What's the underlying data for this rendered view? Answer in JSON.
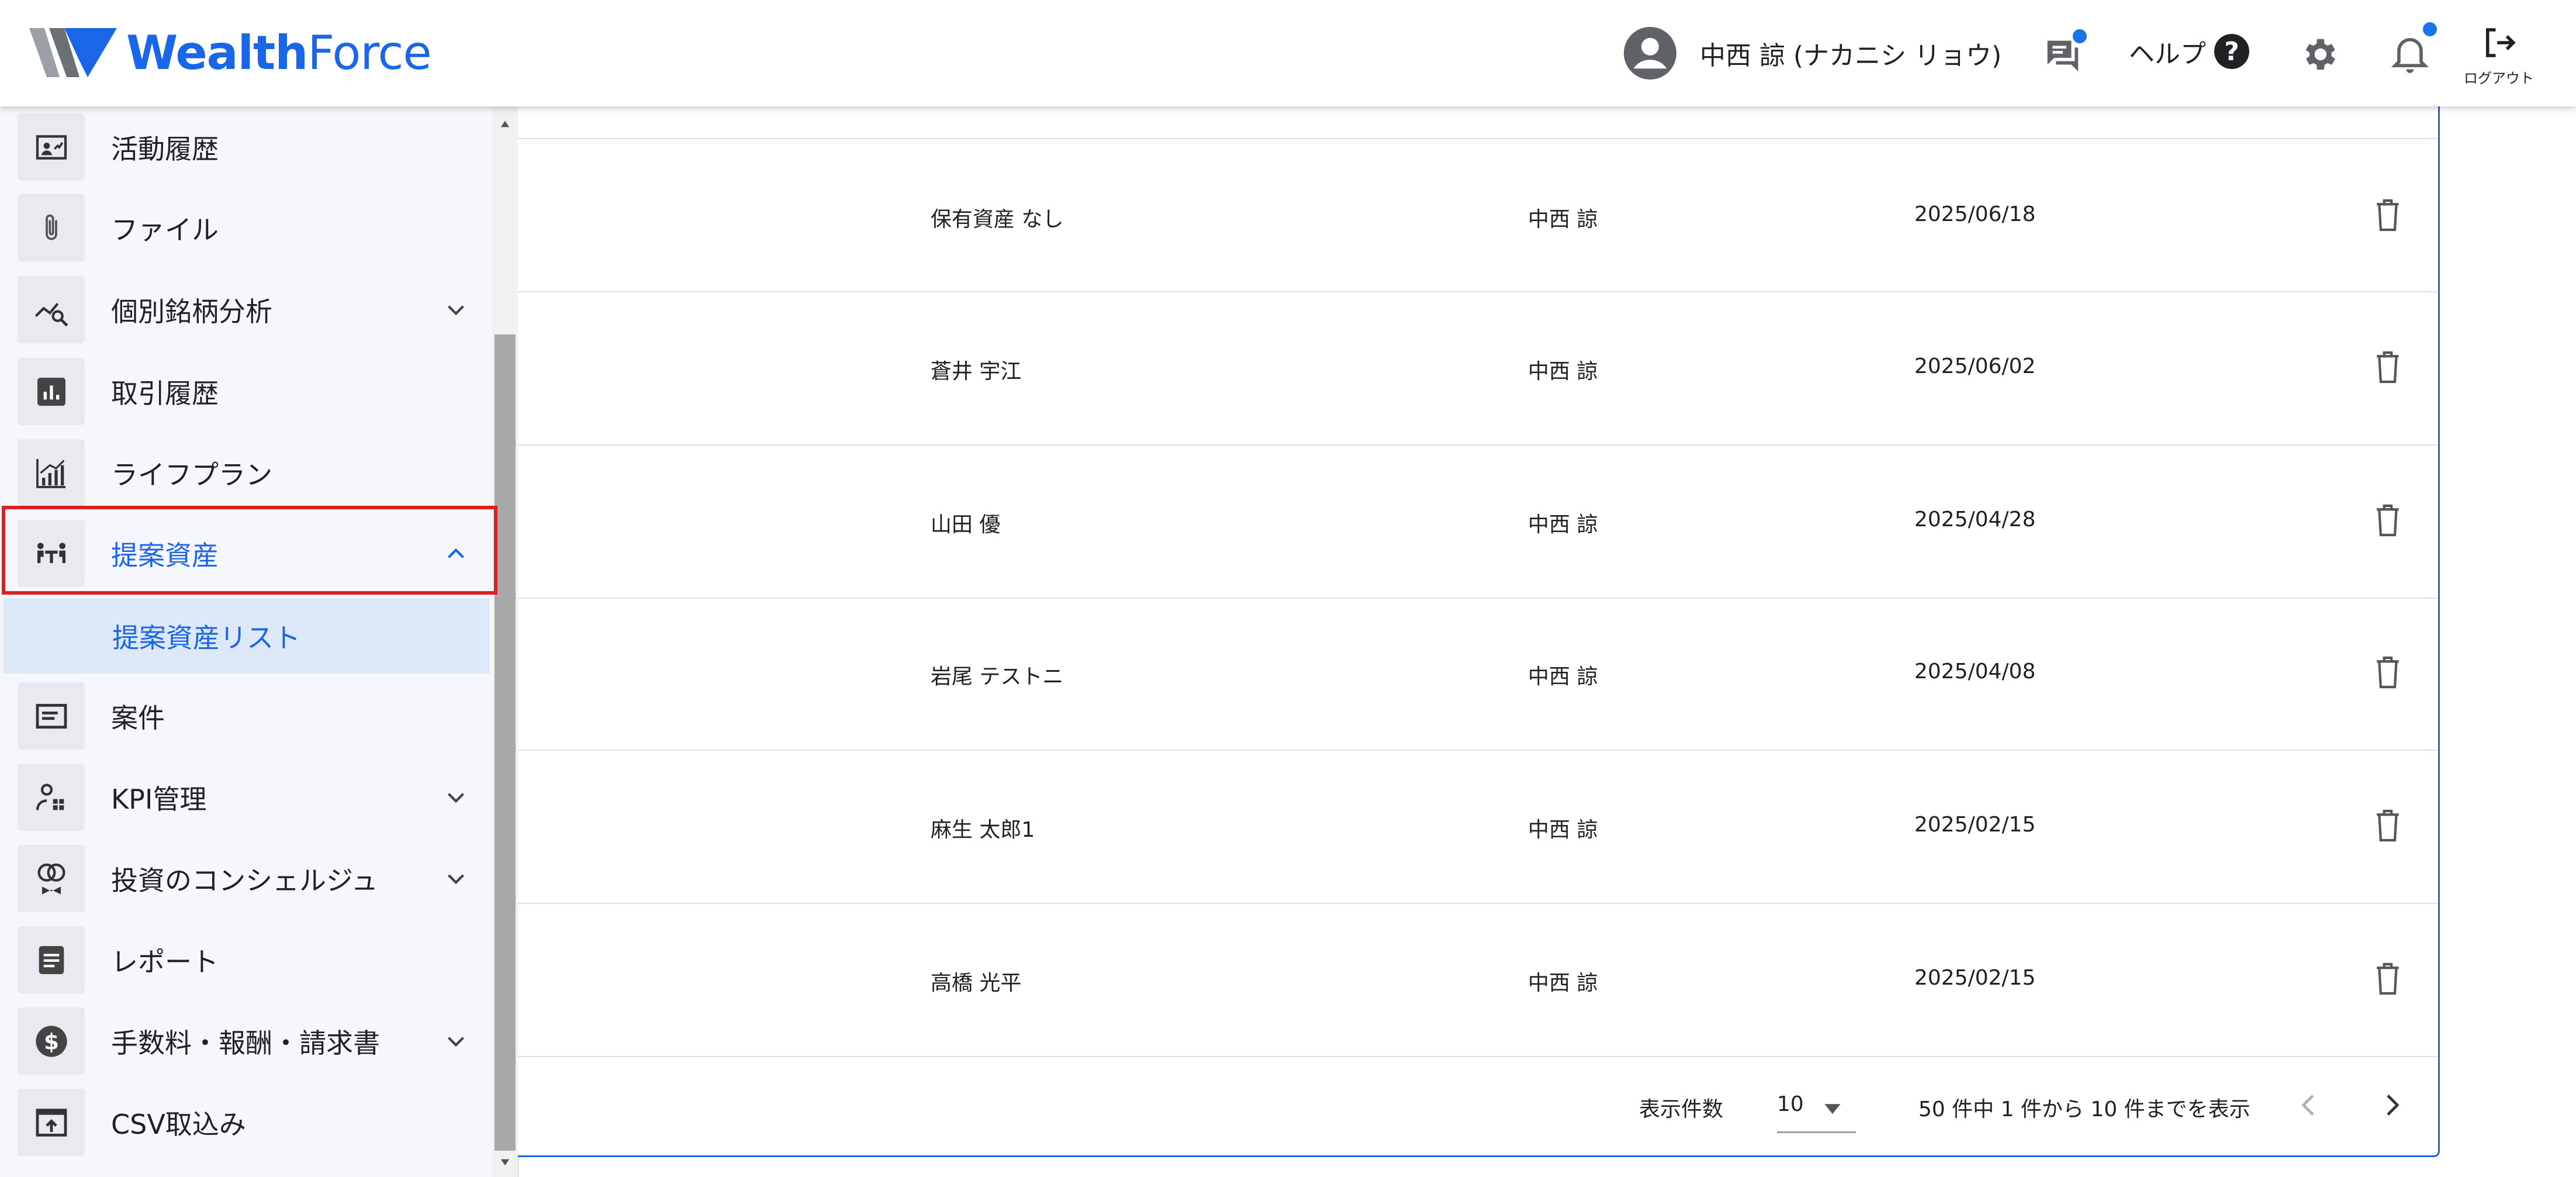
{
  "app": {
    "logo_word1": "Wealth",
    "logo_word2": "Force",
    "brand_color": "#1a66e8"
  },
  "header": {
    "user_name": "中西 諒 (ナカニシ リョウ)",
    "help_label": "ヘルプ",
    "help_glyph": "?",
    "logout_label": "ログアウト",
    "icons": [
      "account-circle-icon",
      "chat-icon",
      "help-icon",
      "gear-icon",
      "bell-icon",
      "logout-icon"
    ]
  },
  "sidebar": {
    "items": [
      {
        "label": "活動履歴",
        "icon": "activity-history-icon",
        "expandable": false
      },
      {
        "label": "ファイル",
        "icon": "paperclip-icon",
        "expandable": false
      },
      {
        "label": "個別銘柄分析",
        "icon": "chart-search-icon",
        "expandable": true
      },
      {
        "label": "取引履歴",
        "icon": "bar-chart-icon",
        "expandable": false
      },
      {
        "label": "ライフプラン",
        "icon": "growth-chart-icon",
        "expandable": false
      },
      {
        "label": "提案資産",
        "icon": "meeting-icon",
        "expandable": true,
        "expanded": true,
        "active": true
      },
      {
        "label": "案件",
        "icon": "card-icon",
        "expandable": false
      },
      {
        "label": "KPI管理",
        "icon": "person-stats-icon",
        "expandable": true
      },
      {
        "label": "投資のコンシェルジュ",
        "icon": "concierge-icon",
        "expandable": true
      },
      {
        "label": "レポート",
        "icon": "document-icon",
        "expandable": false
      },
      {
        "label": "手数料・報酬・請求書",
        "icon": "dollar-icon",
        "expandable": true
      },
      {
        "label": "CSV取込み",
        "icon": "upload-icon",
        "expandable": false
      }
    ],
    "subitem": {
      "label": "提案資産リスト"
    }
  },
  "table": {
    "rows": [
      {
        "name": "保有資産 なし",
        "owner": "中西 諒",
        "date": "2025/06/18"
      },
      {
        "name": "蒼井 宇江",
        "owner": "中西 諒",
        "date": "2025/06/02"
      },
      {
        "name": "山田 優",
        "owner": "中西 諒",
        "date": "2025/04/28"
      },
      {
        "name": "岩尾 テストニ",
        "owner": "中西 諒",
        "date": "2025/04/08"
      },
      {
        "name": "麻生 太郎1",
        "owner": "中西 諒",
        "date": "2025/02/15"
      },
      {
        "name": "高橋 光平",
        "owner": "中西 諒",
        "date": "2025/02/15"
      }
    ]
  },
  "pagination": {
    "rows_per_page_label": "表示件数",
    "rows_per_page_value": "10",
    "range_text": "50 件中 1 件から 10 件までを表示"
  }
}
